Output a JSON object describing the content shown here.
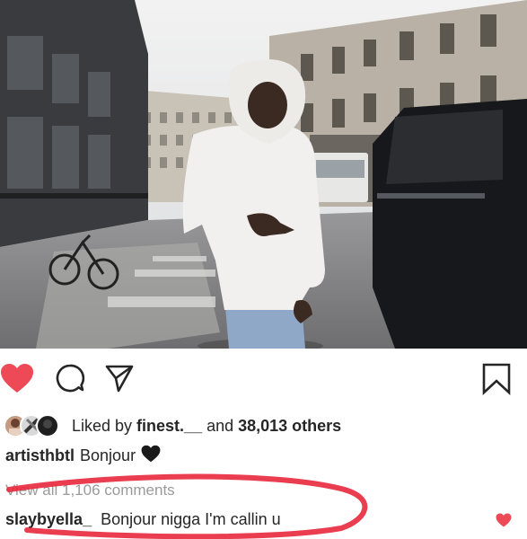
{
  "post": {
    "image_alt": "Man in white hoodie pointing on a Paris street",
    "liked_by_prefix": "Liked by ",
    "liked_by_user": "finest.__",
    "liked_by_and": " and ",
    "liked_by_count": "38,013 others",
    "caption_user": "artisthbtl",
    "caption_text": "Bonjour",
    "caption_emoji": "black-heart",
    "view_comments": "View all 1,106 comments"
  },
  "comment": {
    "user": "slaybyella_",
    "text": "Bonjour nigga I'm callin u"
  },
  "icons": {
    "like": "heart-icon",
    "comment": "comment-icon",
    "share": "share-icon",
    "save": "bookmark-icon"
  },
  "colors": {
    "like_red": "#ed4956",
    "annotation_red": "#e8283c",
    "text": "#262626",
    "muted": "#9a9a9a"
  }
}
